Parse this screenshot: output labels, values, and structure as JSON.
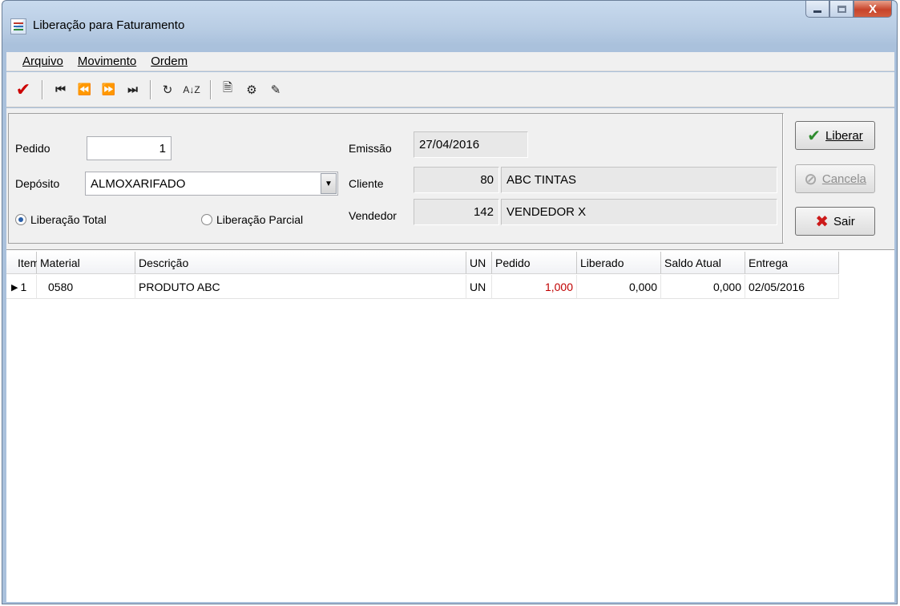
{
  "window": {
    "title": "Liberação para Faturamento",
    "close_glyph": "X"
  },
  "menu": [
    "Arquivo",
    "Movimento",
    "Ordem"
  ],
  "toolbar": {
    "confirm": "✔",
    "first": "⏮",
    "prev": "⏪",
    "next": "⏩",
    "last": "⏭",
    "refresh": "↻",
    "sort": "A↓Z",
    "doc": "🗎",
    "config": "⚙",
    "tool": "✎"
  },
  "form": {
    "pedido_label": "Pedido",
    "pedido_value": "1",
    "emissao_label": "Emissão",
    "emissao_value": "27/04/2016",
    "deposito_label": "Depósito",
    "deposito_value": "ALMOXARIFADO",
    "cliente_label": "Cliente",
    "cliente_code": "80",
    "cliente_name": "ABC TINTAS",
    "vendedor_label": "Vendedor",
    "vendedor_code": "142",
    "vendedor_name": "VENDEDOR X",
    "radio_total": "Liberação Total",
    "radio_parcial": "Liberação Parcial",
    "selected_radio": "total"
  },
  "buttons": {
    "liberar": "Liberar",
    "cancela": "Cancela",
    "sair": "Sair"
  },
  "grid": {
    "columns": [
      "Item",
      "Material",
      "Descrição",
      "UN",
      "Pedido",
      "Liberado",
      "Saldo Atual",
      "Entrega"
    ],
    "rows": [
      {
        "item": "1",
        "material": "0580",
        "descricao": "PRODUTO ABC",
        "un": "UN",
        "pedido": "1,000",
        "liberado": "0,000",
        "saldo": "0,000",
        "entrega": "02/05/2016"
      }
    ]
  }
}
